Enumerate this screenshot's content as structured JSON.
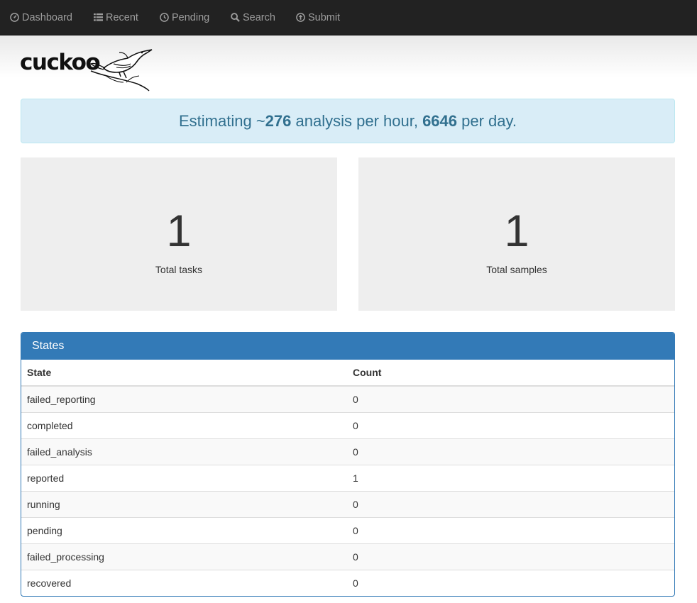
{
  "nav": {
    "items": [
      {
        "label": "Dashboard",
        "icon": "dashboard-icon"
      },
      {
        "label": "Recent",
        "icon": "list-icon"
      },
      {
        "label": "Pending",
        "icon": "clock-icon"
      },
      {
        "label": "Search",
        "icon": "search-icon"
      },
      {
        "label": "Submit",
        "icon": "upload-icon"
      }
    ]
  },
  "logo": {
    "text": "cuckoo"
  },
  "alert": {
    "prefix": "Estimating ~",
    "per_hour": "276",
    "middle": " analysis per hour, ",
    "per_day": "6646",
    "suffix": " per day."
  },
  "stats": {
    "tasks": {
      "value": "1",
      "label": "Total tasks"
    },
    "samples": {
      "value": "1",
      "label": "Total samples"
    }
  },
  "states_panel": {
    "title": "States",
    "columns": [
      "State",
      "Count"
    ],
    "rows": [
      {
        "state": "failed_reporting",
        "count": "0"
      },
      {
        "state": "completed",
        "count": "0"
      },
      {
        "state": "failed_analysis",
        "count": "0"
      },
      {
        "state": "reported",
        "count": "1"
      },
      {
        "state": "running",
        "count": "0"
      },
      {
        "state": "pending",
        "count": "0"
      },
      {
        "state": "failed_processing",
        "count": "0"
      },
      {
        "state": "recovered",
        "count": "0"
      }
    ]
  },
  "colors": {
    "navbar_bg": "#222222",
    "nav_text": "#9d9d9d",
    "alert_bg": "#d9edf7",
    "alert_text": "#31708f",
    "panel_primary": "#337ab7",
    "stat_bg": "#eeeeee"
  }
}
